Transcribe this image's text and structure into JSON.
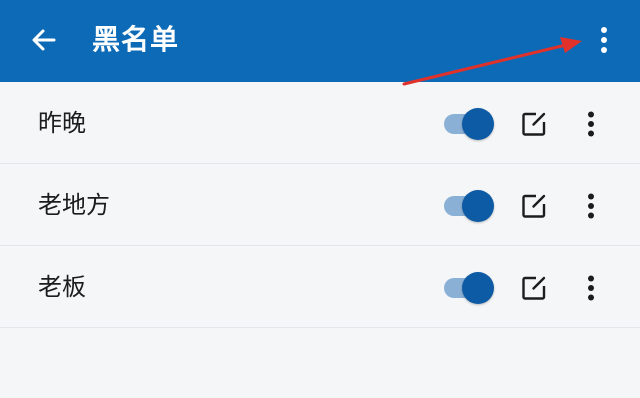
{
  "appbar": {
    "title": "黑名单",
    "back_icon": "back-arrow-icon",
    "more_icon": "more-vert-icon",
    "background_color": "#0d6ab7"
  },
  "blacklist": {
    "items": [
      {
        "label": "昨晚",
        "enabled": true
      },
      {
        "label": "老地方",
        "enabled": true
      },
      {
        "label": "老板",
        "enabled": true
      }
    ],
    "toggle_color": "#0d5aa5",
    "edit_icon": "edit-icon",
    "more_icon": "more-vert-icon"
  },
  "annotation": {
    "arrow_color": "#e0312b"
  }
}
